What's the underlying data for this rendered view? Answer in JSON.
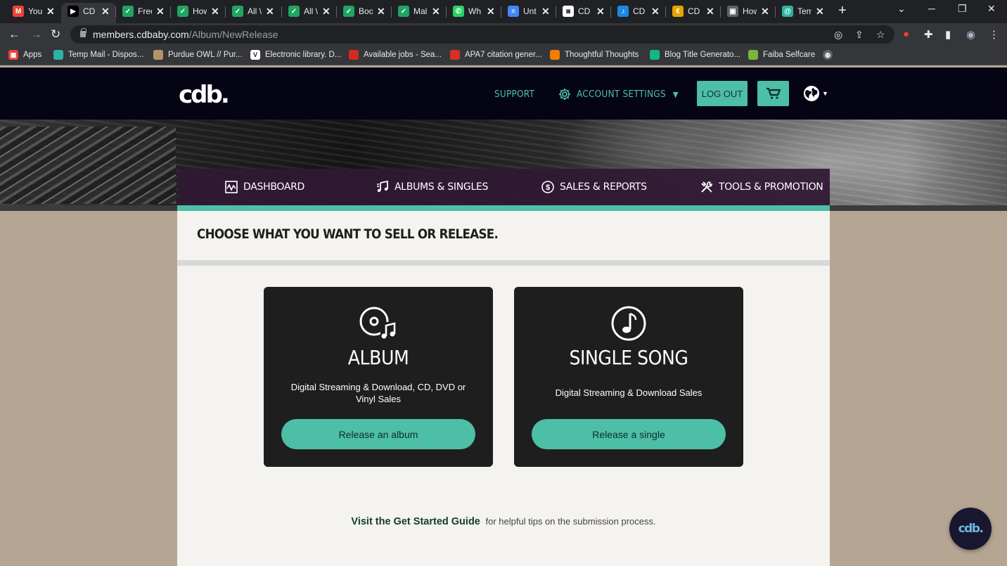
{
  "browser": {
    "tabs": [
      {
        "label": "You",
        "icon": "gmail-icon",
        "color": "#ea4335",
        "glyph": "M"
      },
      {
        "label": "CD",
        "icon": "play-icon",
        "color": "#000000",
        "glyph": "▶"
      },
      {
        "label": "Free",
        "icon": "check-icon",
        "color": "#1fa463",
        "glyph": "✓"
      },
      {
        "label": "How",
        "icon": "check-icon",
        "color": "#1fa463",
        "glyph": "✓"
      },
      {
        "label": "All \\",
        "icon": "check-icon",
        "color": "#1fa463",
        "glyph": "✓"
      },
      {
        "label": "All \\",
        "icon": "check-icon",
        "color": "#1fa463",
        "glyph": "✓"
      },
      {
        "label": "Boo",
        "icon": "check-icon",
        "color": "#1fa463",
        "glyph": "✓"
      },
      {
        "label": "Mal",
        "icon": "check-icon",
        "color": "#1fa463",
        "glyph": "✓"
      },
      {
        "label": "Wh",
        "icon": "whatsapp-icon",
        "color": "#25d366",
        "glyph": "✆"
      },
      {
        "label": "Unt",
        "icon": "docs-icon",
        "color": "#4285f4",
        "glyph": "≡"
      },
      {
        "label": "CD",
        "icon": "cdbaby-icon",
        "color": "#ffffff",
        "glyph": "◙"
      },
      {
        "label": "CD",
        "icon": "music-note-icon",
        "color": "#1e88e5",
        "glyph": "♪"
      },
      {
        "label": "CD",
        "icon": "cd-icon",
        "color": "#e8a400",
        "glyph": "€"
      },
      {
        "label": "How",
        "icon": "page-icon",
        "color": "#5f6368",
        "glyph": "▣"
      },
      {
        "label": "Tem",
        "icon": "temp-mail-icon",
        "color": "#2bb3a3",
        "glyph": "@"
      }
    ],
    "url_domain": "members.cdbaby.com",
    "url_path": "/Album/NewRelease",
    "bookmarks": [
      {
        "label": "Apps",
        "icon": "apps-grid-icon",
        "color": "#ea4335"
      },
      {
        "label": "Temp Mail - Dispos...",
        "icon": "temp-mail-icon",
        "color": "#2bb3a3"
      },
      {
        "label": "Purdue OWL // Pur...",
        "icon": "purdue-icon",
        "color": "#b1946c"
      },
      {
        "label": "Electronic library. D...",
        "icon": "vlib-icon",
        "color": "#ffffff"
      },
      {
        "label": "Available jobs - Sea...",
        "icon": "maple-leaf-icon",
        "color": "#d52b1e"
      },
      {
        "label": "APA7 citation gener...",
        "icon": "pen-icon",
        "color": "#d93025"
      },
      {
        "label": "Thoughtful Thoughts",
        "icon": "blogger-icon",
        "color": "#f57d00"
      },
      {
        "label": "Blog Title Generato...",
        "icon": "lines-icon",
        "color": "#10b981"
      },
      {
        "label": "Faiba Selfcare",
        "icon": "faiba-icon",
        "color": "#7cb342"
      }
    ]
  },
  "header": {
    "logo": "cdb.",
    "support": "SUPPORT",
    "account_settings": "ACCOUNT SETTINGS",
    "logout": "LOG OUT"
  },
  "nav": {
    "dashboard": "DASHBOARD",
    "albums": "ALBUMS & SINGLES",
    "sales": "SALES & REPORTS",
    "tools": "TOOLS & PROMOTION"
  },
  "main": {
    "title": "CHOOSE WHAT YOU WANT TO SELL OR RELEASE.",
    "album": {
      "title": "ALBUM",
      "desc": "Digital Streaming & Download, CD, DVD or Vinyl Sales",
      "button": "Release an album"
    },
    "single": {
      "title": "SINGLE SONG",
      "desc": "Digital Streaming & Download Sales",
      "button": "Release a single"
    },
    "guide_link": "Visit the Get Started Guide",
    "guide_text": "for helpful tips on the submission process."
  },
  "chat": {
    "logo": "cdb."
  },
  "colors": {
    "accent": "#4cbfa6",
    "header": "#050414",
    "nav": "#301934",
    "card": "#1f1e1f",
    "page_bg": "#b5a593"
  }
}
